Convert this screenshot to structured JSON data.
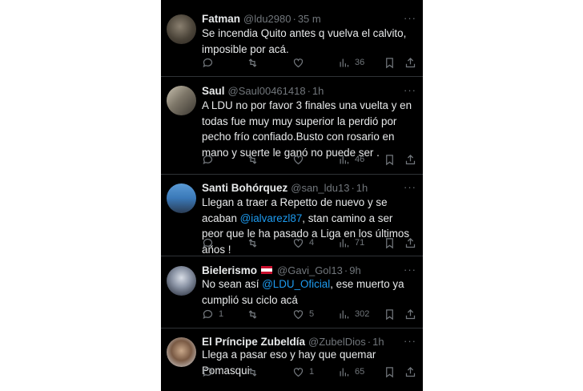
{
  "colors": {
    "background": "#000000",
    "text": "#e7e9ea",
    "muted": "#71767b",
    "link": "#1d9bf0",
    "divider": "#2f3336"
  },
  "tweets": [
    {
      "name": "Fatman",
      "handle": "@ldu2980",
      "sep": "·",
      "time": "35 m",
      "text": "Se incendia Quito antes q vuelva el calvito, imposible por acá.",
      "replies": "",
      "retweets": "",
      "likes": "",
      "views": "36"
    },
    {
      "name": "Saul",
      "handle": "@Saul00461418",
      "sep": "·",
      "time": "1h",
      "text": "A LDU no por favor 3 finales una vuelta y en todas fue muy muy superior la perdió por pecho frío confiado.Busto con rosario en mano y suerte le ganó no puede ser .",
      "replies": "",
      "retweets": "",
      "likes": "",
      "views": "46"
    },
    {
      "name": "Santi Bohórquez",
      "handle": "@san_ldu13",
      "sep": "·",
      "time": "1h",
      "text_before": "Llegan a traer a Repetto de nuevo y se acaban ",
      "mention": "@ialvarezl87",
      "text_after": ", stan camino a ser peor que le ha pasado a Liga en los últimos años !",
      "replies": "",
      "retweets": "",
      "likes": "4",
      "views": "71"
    },
    {
      "name": "Bielerismo",
      "handle": "@Gavi_Gol13",
      "sep": "·",
      "time": "9h",
      "text_before": "No sean así ",
      "mention": "@LDU_Oficial",
      "text_after": ", ese muerto ya cumplió su ciclo acá",
      "replies": "1",
      "retweets": "",
      "likes": "5",
      "views": "302"
    },
    {
      "name": "El Príncipe Zubeldía",
      "handle": "@ZubelDios",
      "sep": "·",
      "time": "1h",
      "text": "Llega a pasar eso y hay que quemar Pomasqui",
      "replies": "",
      "retweets": "",
      "likes": "1",
      "views": "65"
    }
  ],
  "more_label": "···"
}
